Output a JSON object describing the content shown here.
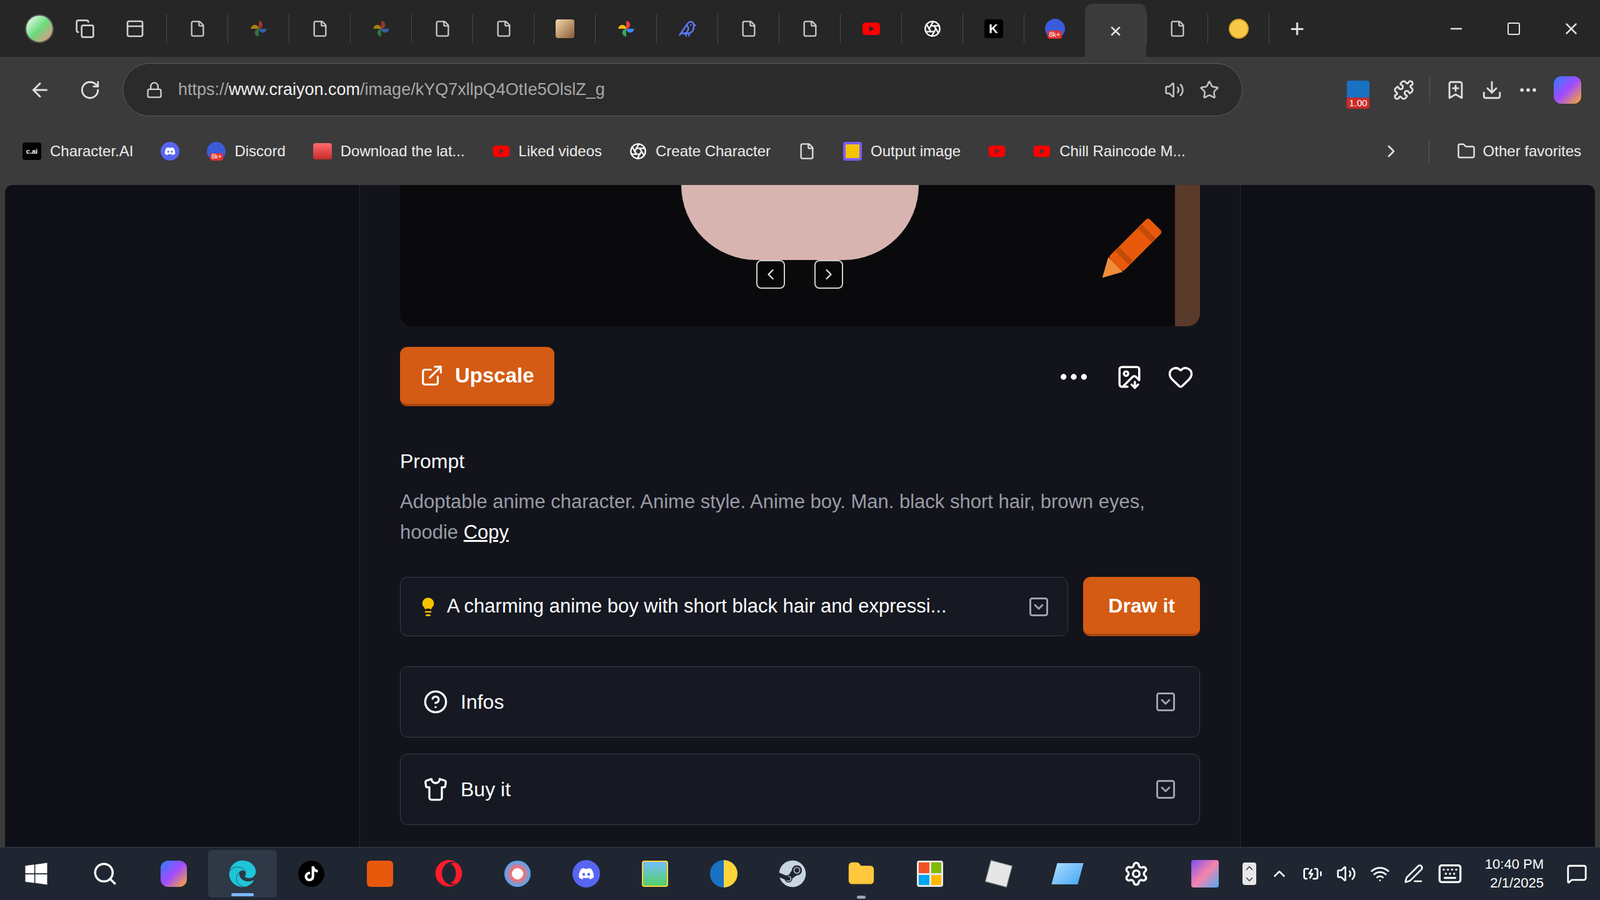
{
  "browser": {
    "tabs": [
      {
        "icon": "doc",
        "selected": false
      },
      {
        "icon": "pinwheel",
        "selected": false
      },
      {
        "icon": "doc",
        "selected": false
      },
      {
        "icon": "pinwheel",
        "selected": false
      },
      {
        "icon": "doc",
        "selected": false
      },
      {
        "icon": "doc",
        "selected": false
      },
      {
        "icon": "photo",
        "selected": false
      },
      {
        "icon": "pinwheel-color",
        "selected": false
      },
      {
        "icon": "bird",
        "selected": false
      },
      {
        "icon": "doc",
        "selected": false
      },
      {
        "icon": "doc",
        "selected": false
      },
      {
        "icon": "youtube",
        "selected": false
      },
      {
        "icon": "openai",
        "selected": false
      },
      {
        "icon": "letter",
        "mark": "K",
        "selected": false
      },
      {
        "icon": "badge",
        "mark": "8k+",
        "selected": false
      },
      {
        "icon": "close",
        "mark": "×",
        "selected": true
      },
      {
        "icon": "doc",
        "selected": false
      },
      {
        "icon": "emoji",
        "selected": false
      }
    ],
    "new_tab": "+",
    "address": {
      "scheme": "https://",
      "host": "www.craiyon.com",
      "path": "/image/kYQ7xllpQ4OtIe5OlslZ_g"
    },
    "extension_badge": "1.00",
    "favorites": [
      {
        "label": "Character.AI",
        "icon": "cai",
        "mark": "c.ai"
      },
      {
        "label": "",
        "icon": "discord"
      },
      {
        "label": "Discord",
        "icon": "badge",
        "mark": "8k+"
      },
      {
        "label": "Download the lat...",
        "icon": "store"
      },
      {
        "label": "Liked videos",
        "icon": "youtube"
      },
      {
        "label": "Create Character",
        "icon": "openai"
      },
      {
        "label": "",
        "icon": "doc"
      },
      {
        "label": "Output image",
        "icon": "yellow"
      },
      {
        "label": "",
        "icon": "youtube"
      },
      {
        "label": "Chill Raincode M...",
        "icon": "youtube"
      }
    ],
    "other_favorites": "Other favorites"
  },
  "page": {
    "upscale": "Upscale",
    "prompt_label": "Prompt",
    "prompt": "Adoptable anime character. Anime style. Anime boy. Man. black short hair, brown eyes, hoodie",
    "copy": "Copy",
    "suggestion": "A charming anime boy with short black hair and expressi...",
    "draw": "Draw it",
    "liked": false,
    "sections": [
      {
        "label": "Infos",
        "icon": "help",
        "expanded": false
      },
      {
        "label": "Buy it",
        "icon": "shirt",
        "expanded": false
      }
    ]
  },
  "taskbar": {
    "apps": [
      {
        "icon": "windows",
        "running": false,
        "selected": false
      },
      {
        "icon": "search",
        "running": false,
        "selected": false
      },
      {
        "icon": "copilot",
        "running": false,
        "selected": false
      },
      {
        "icon": "edge",
        "running": true,
        "selected": true
      },
      {
        "icon": "tiktok",
        "running": false,
        "selected": false
      },
      {
        "icon": "orange-app",
        "running": false,
        "selected": false
      },
      {
        "icon": "opera",
        "running": false,
        "selected": false
      },
      {
        "icon": "paint",
        "running": false,
        "selected": false
      },
      {
        "icon": "discord",
        "running": false,
        "selected": false
      },
      {
        "icon": "photos",
        "running": false,
        "selected": false
      },
      {
        "icon": "blue-app",
        "running": false,
        "selected": false
      },
      {
        "icon": "steam",
        "running": false,
        "selected": false
      },
      {
        "icon": "explorer",
        "running": true,
        "selected": false
      },
      {
        "icon": "store",
        "running": false,
        "selected": false
      },
      {
        "icon": "roblox",
        "running": false,
        "selected": false
      },
      {
        "icon": "glass",
        "running": false,
        "selected": false
      },
      {
        "icon": "settings",
        "running": false,
        "selected": false
      },
      {
        "icon": "avatar",
        "running": false,
        "selected": false
      }
    ],
    "time": "10:40 PM",
    "date": "2/1/2025"
  }
}
